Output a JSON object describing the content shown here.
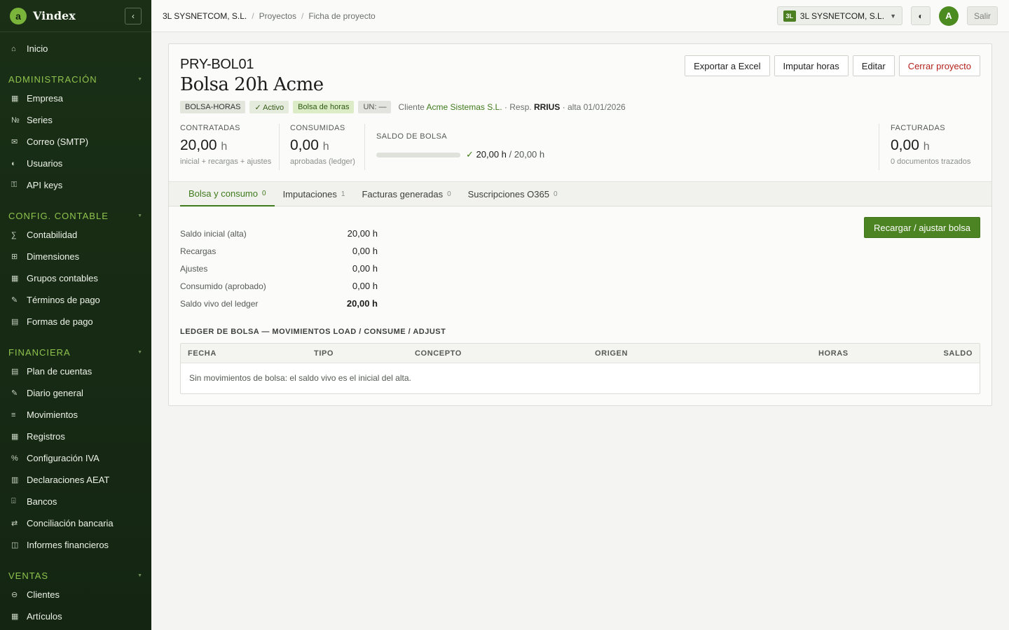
{
  "brand": {
    "name": "Vindex",
    "logo_letter": "a"
  },
  "sidebar": {
    "home": {
      "icon": "⌂",
      "label": "Inicio"
    },
    "sections": [
      {
        "title": "ADMINISTRACIÓN",
        "items": [
          {
            "icon": "▦",
            "label": "Empresa"
          },
          {
            "icon": "№",
            "label": "Series"
          },
          {
            "icon": "✉",
            "label": "Correo (SMTP)"
          },
          {
            "icon": "◐",
            "label": "Usuarios"
          },
          {
            "icon": "⚿",
            "label": "API keys"
          }
        ]
      },
      {
        "title": "CONFIG. CONTABLE",
        "items": [
          {
            "icon": "∑",
            "label": "Contabilidad"
          },
          {
            "icon": "⊞",
            "label": "Dimensiones"
          },
          {
            "icon": "▦",
            "label": "Grupos contables"
          },
          {
            "icon": "✎",
            "label": "Términos de pago"
          },
          {
            "icon": "▤",
            "label": "Formas de pago"
          }
        ]
      },
      {
        "title": "FINANCIERA",
        "items": [
          {
            "icon": "▤",
            "label": "Plan de cuentas"
          },
          {
            "icon": "✎",
            "label": "Diario general"
          },
          {
            "icon": "≡",
            "label": "Movimientos"
          },
          {
            "icon": "▦",
            "label": "Registros"
          },
          {
            "icon": "%",
            "label": "Configuración IVA"
          },
          {
            "icon": "▥",
            "label": "Declaraciones AEAT"
          },
          {
            "icon": "⌹",
            "label": "Bancos"
          },
          {
            "icon": "⇄",
            "label": "Conciliación bancaria"
          },
          {
            "icon": "◫",
            "label": "Informes financieros"
          }
        ]
      },
      {
        "title": "VENTAS",
        "items": [
          {
            "icon": "⊖",
            "label": "Clientes"
          },
          {
            "icon": "▦",
            "label": "Artículos"
          }
        ]
      }
    ]
  },
  "topbar": {
    "breadcrumb": [
      "3L SYSNETCOM, S.L.",
      "Proyectos",
      "Ficha de proyecto"
    ],
    "company_badge": "3L",
    "company": "3L SYSNETCOM, S.L.",
    "logout": "Salir",
    "avatar": "A"
  },
  "project": {
    "code": "PRY-BOL01",
    "title": "Bolsa 20h Acme",
    "tags": {
      "code": "BOLSA-HORAS",
      "status": "✓ Activo",
      "type": "Bolsa de horas",
      "un": "UN: —"
    },
    "meta": {
      "client_prefix": "Cliente",
      "client": "Acme Sistemas S.L.",
      "resp_prefix": "· Resp.",
      "resp": "RRIUS",
      "alta": "· alta 01/01/2026"
    }
  },
  "actions": {
    "export": "Exportar a Excel",
    "impute": "Imputar horas",
    "edit": "Editar",
    "close": "Cerrar proyecto"
  },
  "stats": {
    "contracted": {
      "label": "CONTRATADAS",
      "value": "20,00",
      "unit": "h",
      "sub": "inicial + recargas + ajustes"
    },
    "consumed": {
      "label": "CONSUMIDAS",
      "value": "0,00",
      "unit": "h",
      "sub": "aprobadas (ledger)"
    },
    "balance": {
      "label": "SALDO DE BOLSA",
      "check": "✓",
      "current": "20,00 h",
      "total": "/ 20,00 h",
      "fill_fraction": 1.0
    },
    "invoiced": {
      "label": "FACTURADAS",
      "value": "0,00",
      "unit": "h",
      "sub": "0 documentos trazados"
    }
  },
  "tabs": [
    {
      "label": "Bolsa y consumo",
      "count": "0",
      "active": true
    },
    {
      "label": "Imputaciones",
      "count": "1"
    },
    {
      "label": "Facturas generadas",
      "count": "0"
    },
    {
      "label": "Suscripciones O365",
      "count": "0"
    }
  ],
  "recharge_button": "Recargar / ajustar bolsa",
  "summary": [
    {
      "label": "Saldo inicial (alta)",
      "value": "20,00 h"
    },
    {
      "label": "Recargas",
      "value": "0,00 h"
    },
    {
      "label": "Ajustes",
      "value": "0,00 h"
    },
    {
      "label": "Consumido (aprobado)",
      "value": "0,00 h"
    },
    {
      "label": "Saldo vivo del ledger",
      "value": "20,00 h"
    }
  ],
  "ledger": {
    "title": "LEDGER DE BOLSA — MOVIMIENTOS LOAD / CONSUME / ADJUST",
    "columns": [
      "FECHA",
      "TIPO",
      "CONCEPTO",
      "ORIGEN",
      "HORAS",
      "SALDO"
    ],
    "empty": "Sin movimientos de bolsa: el saldo vivo es el inicial del alta."
  },
  "colors": {
    "sidebar": "#1a2f16",
    "accent": "#4c8424",
    "danger": "#b3221b"
  }
}
